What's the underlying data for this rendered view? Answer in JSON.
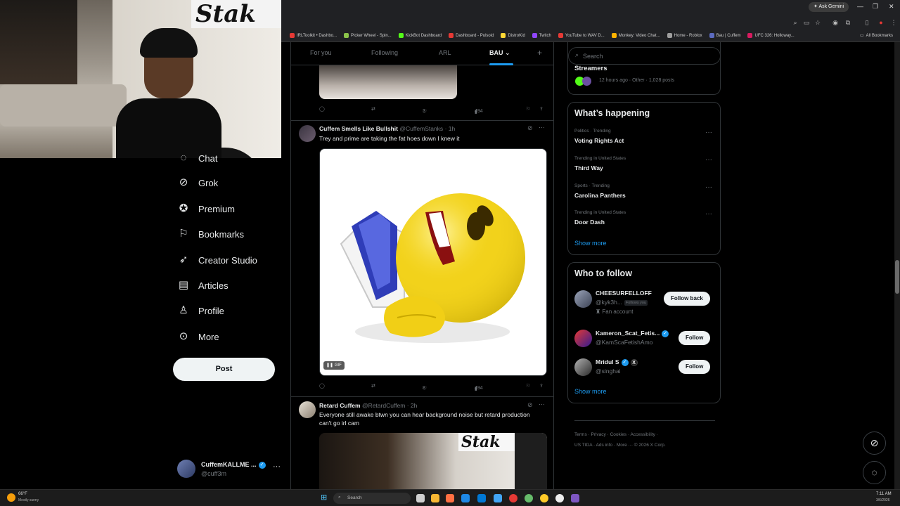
{
  "browser": {
    "ask_gemini": "Ask Gemini",
    "bookmarks": [
      {
        "label": "IRLToolkit • Dashbo...",
        "color": "#e53935"
      },
      {
        "label": "Picker Wheel - Spin...",
        "color": "#8bc34a"
      },
      {
        "label": "KickBot Dashboard",
        "color": "#53fc18"
      },
      {
        "label": "Dashboard - Pulsoid",
        "color": "#e53935"
      },
      {
        "label": "DistroKid",
        "color": "#fdd835"
      },
      {
        "label": "Twitch",
        "color": "#9146ff"
      },
      {
        "label": "YouTube to WAV D...",
        "color": "#e53935"
      },
      {
        "label": "Monkey: Video Chat...",
        "color": "#ffb300"
      },
      {
        "label": "Home - Roblox",
        "color": "#9e9e9e"
      },
      {
        "label": "Bau | Cuffem",
        "color": "#5c6bc0"
      },
      {
        "label": "UFC 326: Holloway...",
        "color": "#d81b60"
      }
    ],
    "all_bookmarks": "All Bookmarks"
  },
  "nav": {
    "items": [
      {
        "label": "Chat",
        "icon": "chat-icon"
      },
      {
        "label": "Grok",
        "icon": "grok-icon"
      },
      {
        "label": "Premium",
        "icon": "premium-icon"
      },
      {
        "label": "Bookmarks",
        "icon": "bookmark-icon"
      },
      {
        "label": "Creator Studio",
        "icon": "rocket-icon"
      },
      {
        "label": "Articles",
        "icon": "articles-icon"
      },
      {
        "label": "Profile",
        "icon": "person-icon"
      },
      {
        "label": "More",
        "icon": "more-circle-icon"
      }
    ],
    "post_label": "Post",
    "account": {
      "name": "CuffemKALLME ...",
      "handle": "@cuff3m"
    }
  },
  "timeline": {
    "tabs": [
      "For you",
      "Following",
      "ARL",
      "BAU"
    ],
    "active_tab": "BAU",
    "tweets": [
      {
        "replies": "",
        "reposts": "",
        "likes": "3",
        "views": "494"
      },
      {
        "name": "Cuffem Smells Like Bullshit",
        "handle": "@CuffemStanks",
        "time": "1h",
        "text": "Trey and prime are taking the fat hoes down I knew it",
        "media_badge": "GIF",
        "likes": "8",
        "views": "494"
      },
      {
        "name": "Retard Cuffem",
        "handle": "@RetardCuffem",
        "time": "2h",
        "text": "Everyone still awake btwn you can hear background noise but retard production can't go irl cam"
      }
    ]
  },
  "sidebar": {
    "search_placeholder": "Search",
    "streamers": {
      "title": "Streamers",
      "meta": "12 hours ago · Other · 1,028 posts"
    },
    "happening_title": "What’s happening",
    "trends": [
      {
        "category": "Politics · Trending",
        "name": "Voting Rights Act"
      },
      {
        "category": "Trending in United States",
        "name": "Third Way"
      },
      {
        "category": "Sports · Trending",
        "name": "Carolina Panthers"
      },
      {
        "category": "Trending in United States",
        "name": "Door Dash"
      }
    ],
    "show_more": "Show more",
    "who_to_follow_title": "Who to follow",
    "suggestions": [
      {
        "name": "CHEESURFELLOFF",
        "handle": "@kyk3h...",
        "badge": "Follows you",
        "extra": "Fan account",
        "button": "Follow back"
      },
      {
        "name": "Kameron_Scat_Fetis...",
        "handle": "@KamScaFetishAmo",
        "button": "Follow"
      },
      {
        "name": "Mridul S",
        "handle": "@singhai",
        "button": "Follow"
      }
    ],
    "footer": {
      "line1": [
        "Terms",
        "Privacy",
        "Cookies",
        "Accessibility"
      ],
      "line2": [
        "US TIDA",
        "Ads info",
        "More ···",
        "© 2026 X Corp."
      ]
    }
  },
  "taskbar": {
    "temp": "66°F",
    "weather": "Mostly sunny",
    "search": "Search",
    "time": "7:11 AM",
    "date": "3/6/2026"
  },
  "colors": {
    "accent": "#1d9bf0",
    "background": "#000000",
    "border": "#2f3336"
  }
}
